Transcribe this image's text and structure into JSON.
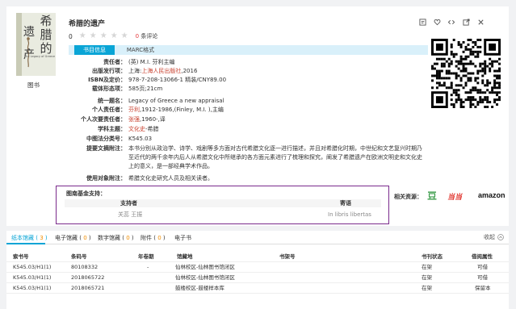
{
  "book": {
    "title": "希腊的遗产",
    "cover_label": "图书",
    "cover_text": {
      "char1": "遗",
      "char2": "产",
      "char3": "希",
      "char4": "腊",
      "char5": "的",
      "english": "The Legacy of Greece"
    },
    "score": "0",
    "star_count": 5,
    "comment_count": "0",
    "comment_label": "条评论",
    "tabs": {
      "active": "书目信息",
      "other": "MARC格式"
    }
  },
  "meta": {
    "responsible": {
      "label": "责任者：",
      "value": "(英) M.I. 芬利主编"
    },
    "publisher": {
      "label": "出版发行项：",
      "prefix": "上海:",
      "link": "上海人民出版社",
      "suffix": ",2016"
    },
    "isbn": {
      "label": "ISBN及定价：",
      "value": "978-7-208-13066-1 精装/CNY89.00"
    },
    "physical": {
      "label": "载体形态项：",
      "value": "585页;21cm"
    },
    "uniform_title": {
      "label": "统一题名：",
      "value": "Legacy of Greece a new appraisal"
    },
    "personal": {
      "label": "个人责任者：",
      "link": "芬利",
      "suffix": ",1912-1986,(Finley, M.I. ),主编"
    },
    "secondary": {
      "label": "个人次要责任者：",
      "link": "张强",
      "suffix": ",1960-,译"
    },
    "subject": {
      "label": "学科主题：",
      "link": "文化史",
      "suffix": "-希腊"
    },
    "clc": {
      "label": "中图法分类号：",
      "value": "K545.03"
    },
    "summary": {
      "label": "提要文摘附注：",
      "value": "本书分别从政治学、诗学、戏剧等多方面对古代希腊文化逐一进行描述，并且对希腊化时期，中世纪和文艺复兴时期乃至近代的两千余年内后人从希腊文化中所继承的各方面元素进行了梳理和探究，阐发了希腊遗产在欧洲文明史和文化史上的意义，是一部经典学术作品。"
    },
    "audience": {
      "label": "使用对象附注：",
      "value": "希腊文化史研究人员及相关读者。"
    }
  },
  "fund": {
    "title": "图南基金支持：",
    "col_supporter": "支持者",
    "col_message": "寄语",
    "supporter": "关蕊 王振",
    "message": "In libris libertas"
  },
  "related": {
    "label": "相关资源：",
    "logo1": "豆瓣",
    "logo2": "当当",
    "logo3": "amazon"
  },
  "holdings": {
    "tabs": [
      {
        "label": "纸本馆藏",
        "count": "3"
      },
      {
        "label": "电子馆藏",
        "count": "0"
      },
      {
        "label": "数字馆藏",
        "count": "0"
      },
      {
        "label": "附件",
        "count": "0"
      },
      {
        "label": "电子书",
        "count": ""
      }
    ],
    "collapse_label": "收起",
    "columns": [
      "索书号",
      "条码号",
      "年卷期",
      "馆藏地",
      "书架号",
      "书刊状态",
      "借阅属性"
    ],
    "rows": [
      [
        "K545.03/H1(1)",
        "80108332",
        "-",
        "仙林校区-仙林图书馆闭区",
        "",
        "在架",
        "可借"
      ],
      [
        "K545.03/H1(1)",
        "2018065722",
        "",
        "仙林校区-仙林图书馆闭区",
        "",
        "在架",
        "可借"
      ],
      [
        "K545.03/H1(1)",
        "2018065721",
        "",
        "鼓楼校区-鼓楼样本库",
        "",
        "在架",
        "保留本"
      ]
    ]
  },
  "colors": {
    "accent": "#0aa5d6",
    "link": "#c83f2d",
    "fund_border": "#7a2a8c",
    "count": "#f08c00"
  }
}
